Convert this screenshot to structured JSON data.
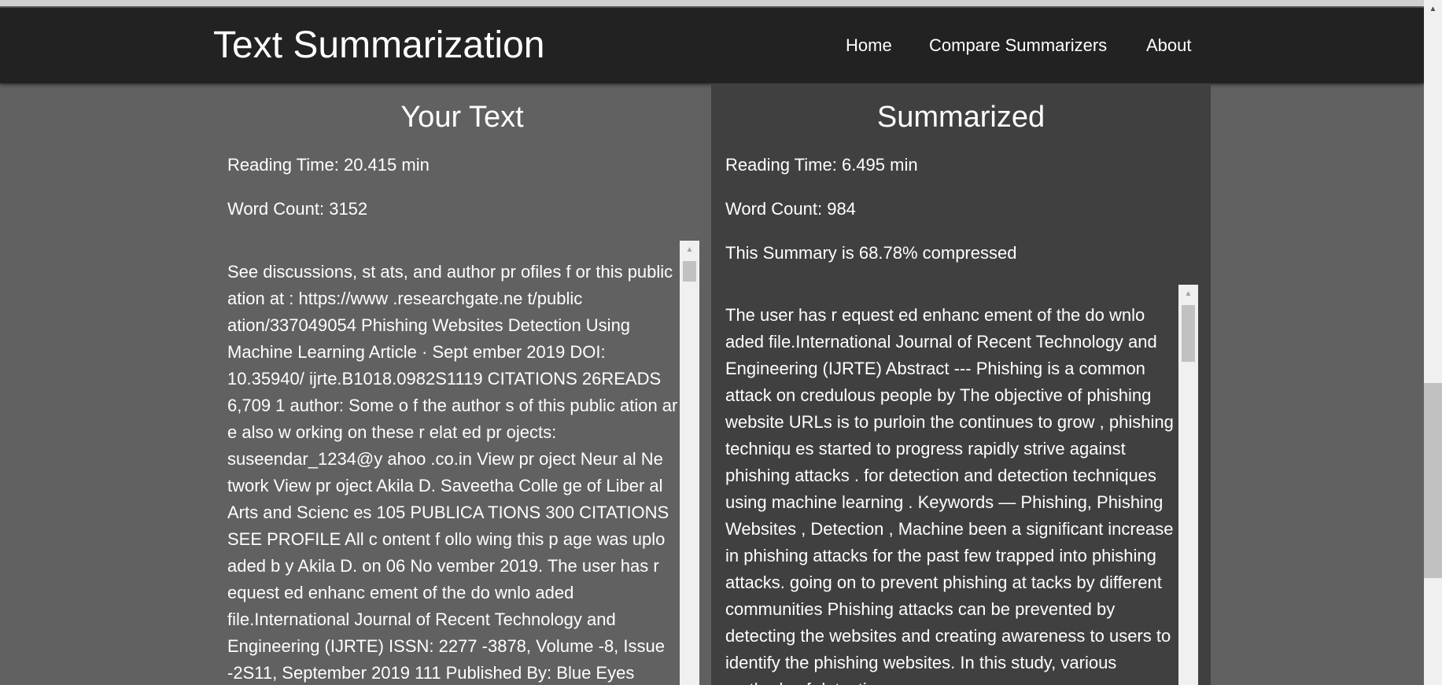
{
  "navbar": {
    "brand": "Text Summarization",
    "links": [
      "Home",
      "Compare Summarizers",
      "About"
    ]
  },
  "left": {
    "heading": "Your Text",
    "reading_time": "Reading Time: 20.415 min",
    "word_count": "Word Count: 3152",
    "text": "See discussions, st ats, and author pr ofiles f or this public ation at : https://www .researchgate.ne t/public ation/337049054 Phishing Websites Detection Using Machine Learning Article · Sept ember 2019 DOI: 10.35940/ ijrte.B1018.0982S1119 CITATIONS 26READS 6,709 1 author: Some o f the author s of this public ation ar e also w orking on these r elat ed pr ojects: suseendar_1234@y ahoo .co.in View pr oject Neur al Ne twork View pr oject Akila D. Saveetha Colle ge of Liber al Arts and Scienc es 105 PUBLICA TIONS    300 CITATIONS     SEE PROFILE All c ontent f ollo wing this p age was uplo aded b y Akila D. on 06 No vember 2019. The user has r equest ed enhanc ement of the do wnlo aded file.International Journal of Recent Technology and Engineering (IJRTE) ISSN: 2277 -3878, Volume -8, Issue -2S11, September 2019 111 Published By: Blue Eyes"
  },
  "right": {
    "heading": "Summarized",
    "reading_time": "Reading Time: 6.495 min",
    "word_count": "Word Count: 984",
    "compression": "This Summary is 68.78% compressed",
    "text": "The user has r equest ed enhanc ement of the do wnlo aded file.International Journal of Recent Technology and Engineering (IJRTE) Abstract --- Phishing is a common attack on credulous people by The objective of phishing website URLs is to purloin the continues to grow , phishing techniqu es started to progress rapidly strive against phishing attacks . for detection and detection techniques using machine learning . Keywords — Phishing, Phishing Websites , Detection , Machine been a significant increase in phishing attacks for the past few trapped into phishing attacks. going on to prevent phishing at tacks by different communities Phishing attacks can be prevented by detecting the websites and creating awareness to users to identify the phishing websites. In this study, various methods of detecting"
  }
}
